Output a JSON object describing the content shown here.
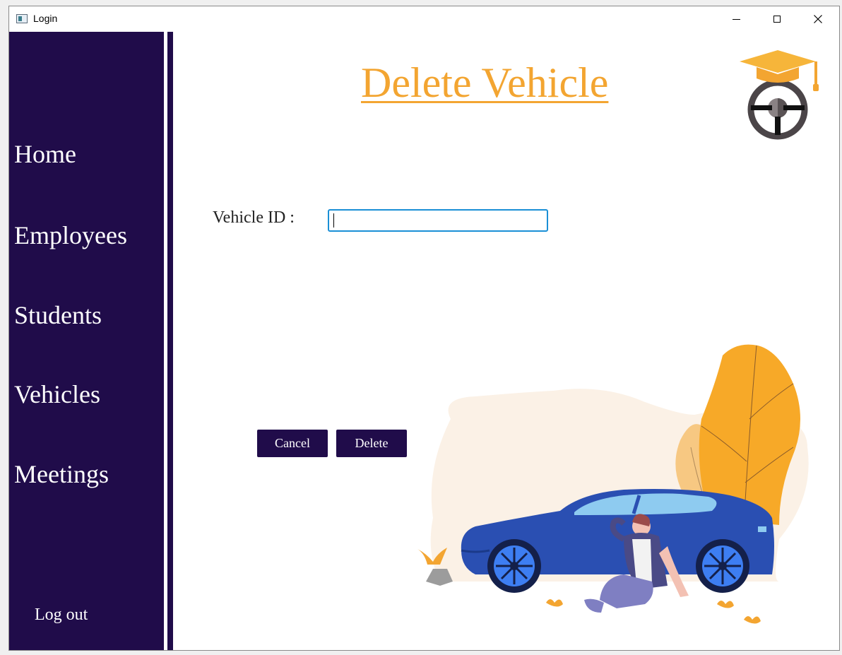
{
  "window": {
    "title": "Login"
  },
  "sidebar": {
    "items": [
      {
        "label": "Home"
      },
      {
        "label": "Employees"
      },
      {
        "label": "Students"
      },
      {
        "label": "Vehicles"
      },
      {
        "label": "Meetings"
      }
    ],
    "logout_label": "Log out"
  },
  "main": {
    "title": "Delete Vehicle",
    "vehicle_id": {
      "label": "Vehicle ID :",
      "value": ""
    },
    "buttons": {
      "cancel_label": "Cancel",
      "delete_label": "Delete"
    }
  },
  "icons": {
    "logo": "steering-wheel-graduation-cap-icon",
    "minimize": "minimize-icon",
    "maximize": "maximize-icon",
    "close": "close-icon"
  },
  "colors": {
    "sidebar": "#200c4a",
    "accent": "#f3a531",
    "input_focus": "#1a8fd6",
    "button": "#200c4a"
  }
}
